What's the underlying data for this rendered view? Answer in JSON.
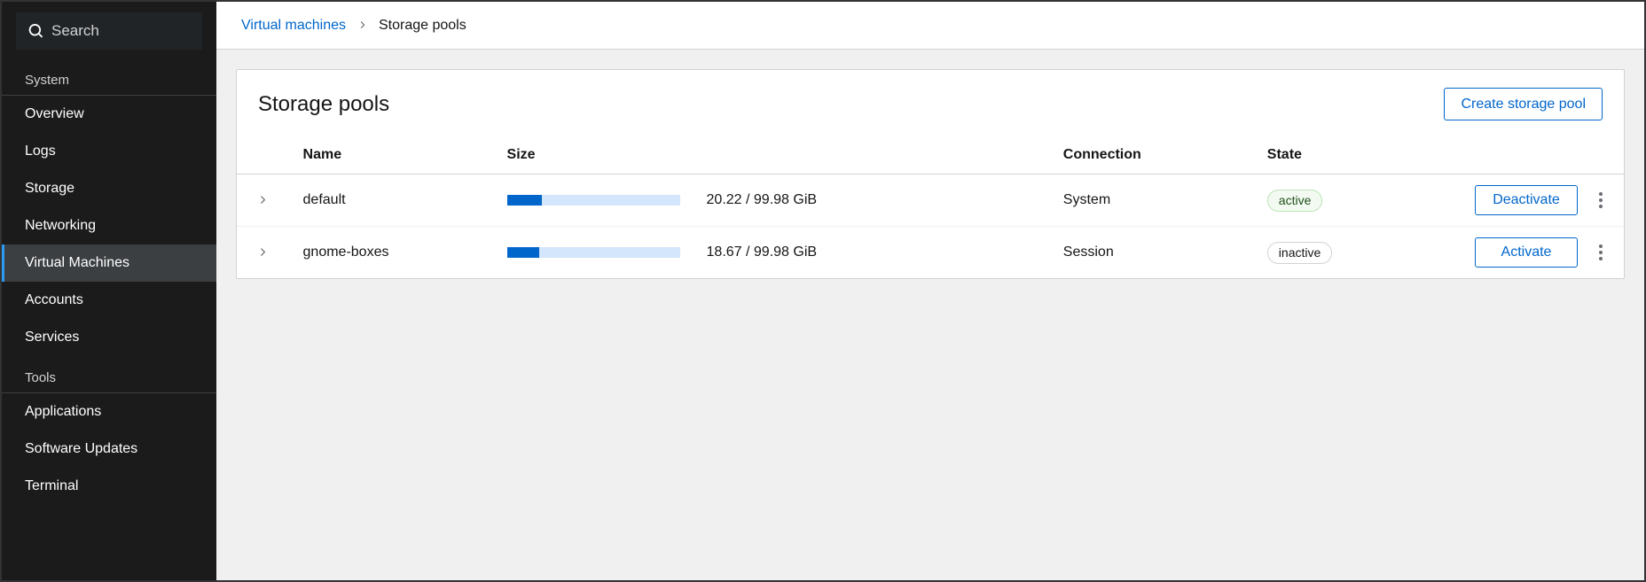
{
  "sidebar": {
    "search_placeholder": "Search",
    "sections": [
      {
        "label": "System",
        "items": [
          {
            "label": "Overview",
            "active": false
          },
          {
            "label": "Logs",
            "active": false
          },
          {
            "label": "Storage",
            "active": false
          },
          {
            "label": "Networking",
            "active": false
          },
          {
            "label": "Virtual Machines",
            "active": true
          },
          {
            "label": "Accounts",
            "active": false
          },
          {
            "label": "Services",
            "active": false
          }
        ]
      },
      {
        "label": "Tools",
        "items": [
          {
            "label": "Applications",
            "active": false
          },
          {
            "label": "Software Updates",
            "active": false
          },
          {
            "label": "Terminal",
            "active": false
          }
        ]
      }
    ]
  },
  "breadcrumb": {
    "link": "Virtual machines",
    "current": "Storage pools"
  },
  "page": {
    "title": "Storage pools",
    "create_label": "Create storage pool"
  },
  "table": {
    "headers": {
      "name": "Name",
      "size": "Size",
      "connection": "Connection",
      "state": "State"
    },
    "rows": [
      {
        "name": "default",
        "used": 20.22,
        "total": 99.98,
        "unit": "GiB",
        "size_text": "20.22 / 99.98 GiB",
        "percent": 20.22,
        "connection": "System",
        "state": "active",
        "action_label": "Deactivate"
      },
      {
        "name": "gnome-boxes",
        "used": 18.67,
        "total": 99.98,
        "unit": "GiB",
        "size_text": "18.67 / 99.98 GiB",
        "percent": 18.67,
        "connection": "Session",
        "state": "inactive",
        "action_label": "Activate"
      }
    ]
  }
}
